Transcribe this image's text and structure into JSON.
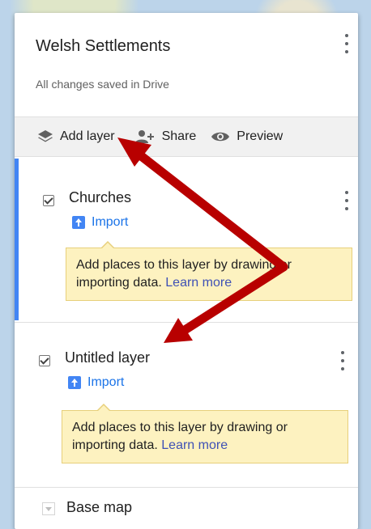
{
  "map": {
    "title": "Welsh Settlements",
    "status": "All changes saved in Drive"
  },
  "toolbar": {
    "add_layer": "Add layer",
    "share": "Share",
    "preview": "Preview"
  },
  "layers": [
    {
      "name": "Churches",
      "checked": true,
      "import_label": "Import",
      "tip_text": "Add places to this layer by drawing or importing data.",
      "tip_link": "Learn more"
    },
    {
      "name": "Untitled layer",
      "checked": true,
      "import_label": "Import",
      "tip_text": "Add places to this layer by drawing or importing data.",
      "tip_link": "Learn more"
    }
  ],
  "base_map": {
    "label": "Base map"
  },
  "annotation": {
    "arrow_color": "#c00000"
  },
  "colors": {
    "accent": "#4285f4",
    "link": "#3f51b5",
    "tip_bg": "#fdf2c0"
  }
}
